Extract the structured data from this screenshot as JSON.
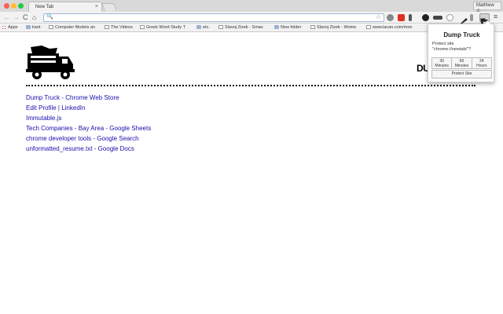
{
  "tab": {
    "title": "New Tab",
    "close": "×"
  },
  "profile": {
    "name": "Matthew ⚠"
  },
  "toolbar": {
    "back": "←",
    "forward": "→",
    "reload": "C",
    "home": "⌂",
    "search": "🔍",
    "star": "☆",
    "menu": "≡"
  },
  "bookmarks": [
    {
      "label": "Apps",
      "icon": "apps-icon"
    },
    {
      "label": "kant",
      "icon": "folder-icon"
    },
    {
      "label": "Computer Models an",
      "icon": "page-icon"
    },
    {
      "label": "The Videos",
      "icon": "page-icon"
    },
    {
      "label": "Greek Word Study T",
      "icon": "page-icon"
    },
    {
      "label": "etc.",
      "icon": "folder-icon"
    },
    {
      "label": "Slavoj Zizek - Smas",
      "icon": "page-icon"
    },
    {
      "label": "New folder",
      "icon": "folder-icon"
    },
    {
      "label": "Slavoj Zizek - Wome",
      "icon": "page-icon"
    },
    {
      "label": "www.lacan.com/moo",
      "icon": "page-icon"
    }
  ],
  "page": {
    "brand_partial": "DU",
    "links": [
      "Dump Truck - Chrome Web Store",
      "Edit Profile | LinkedIn",
      "Immutable.js",
      "Tech Companies - Bay Area - Google Sheets",
      "chrome developer tools - Google Search",
      "unformatted_resume.txt - Google Docs"
    ]
  },
  "popup": {
    "title": "Dump Truck",
    "protect_line1": "Protect site",
    "protect_line2": "\"chrome://newtab/\"?",
    "buttons": [
      {
        "line1": "30",
        "line2": "Minutes"
      },
      {
        "line1": "60",
        "line2": "Minutes"
      },
      {
        "line1": "24",
        "line2": "Hours"
      }
    ],
    "protect_button": "Protect Site"
  },
  "colors": {
    "link": "#1a0dab",
    "accent": "#e0301e"
  }
}
